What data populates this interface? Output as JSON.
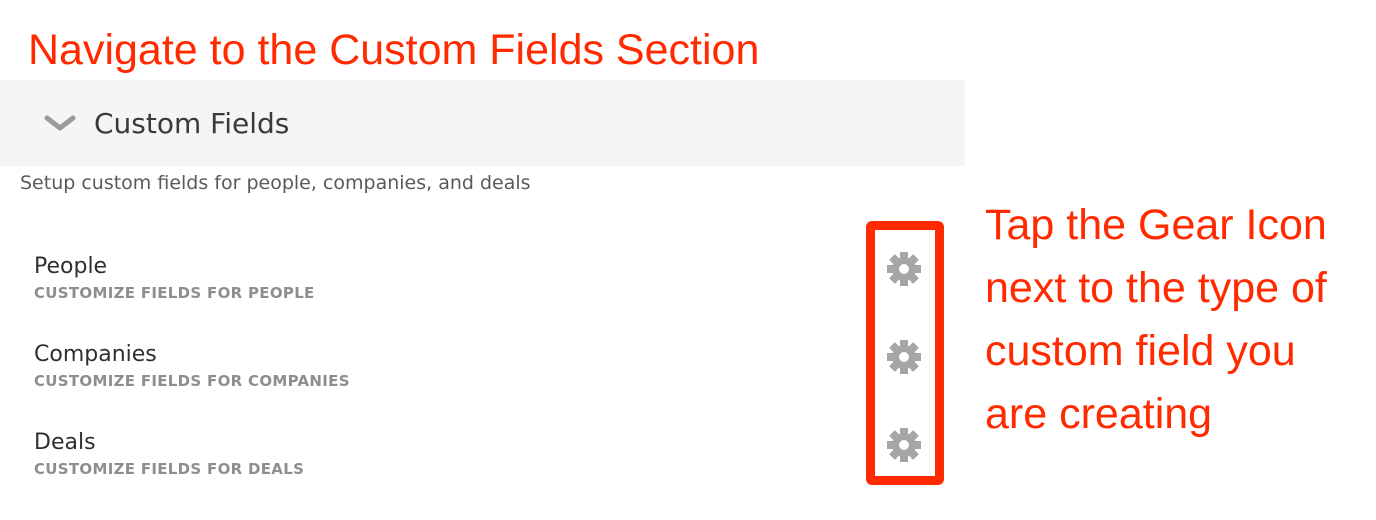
{
  "annotations": {
    "top_instruction": "Navigate to the Custom Fields Section",
    "side_instruction": "Tap the Gear Icon next to the type of custom field you are creating"
  },
  "section": {
    "title": "Custom Fields",
    "description": "Setup custom fields for people, companies, and deals",
    "expand_icon": "chevron-down-icon"
  },
  "rows": [
    {
      "title": "People",
      "subtitle": "CUSTOMIZE FIELDS FOR PEOPLE",
      "icon": "gear-icon"
    },
    {
      "title": "Companies",
      "subtitle": "CUSTOMIZE FIELDS FOR COMPANIES",
      "icon": "gear-icon"
    },
    {
      "title": "Deals",
      "subtitle": "CUSTOMIZE FIELDS FOR DEALS",
      "icon": "gear-icon"
    }
  ],
  "colors": {
    "annotation": "#ff2a00",
    "header_bg": "#f5f5f5",
    "gear": "#a6a6a6"
  }
}
